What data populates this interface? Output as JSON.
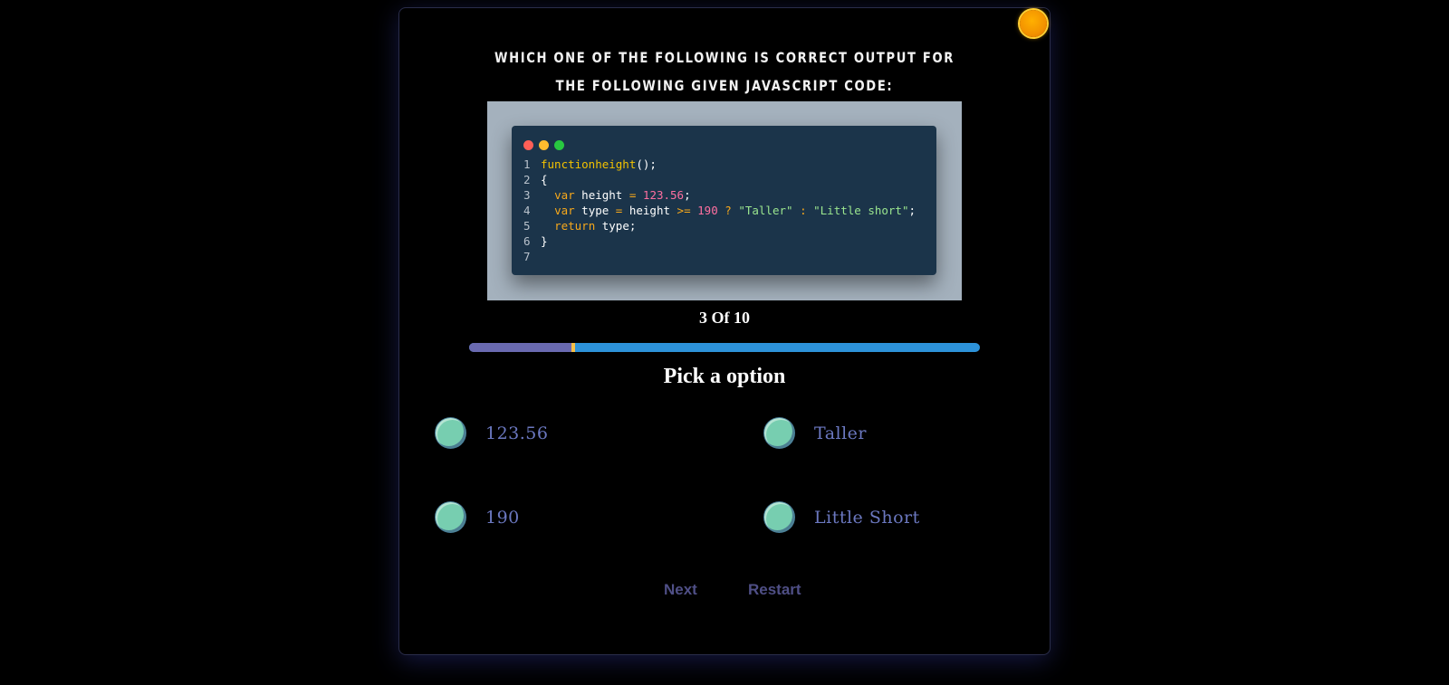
{
  "theme": {
    "toggle_icon": "sun-icon",
    "toggle_color": "#f39200"
  },
  "question": {
    "text": "WHICH ONE OF THE FOLLOWING IS CORRECT OUTPUT FOR THE FOLLOWING GIVEN JAVASCRIPT CODE:"
  },
  "code": {
    "window_dots": [
      "#ff5f57",
      "#febc2e",
      "#28c840"
    ],
    "line_numbers": [
      "1",
      "2",
      "3",
      "4",
      "5",
      "6",
      "7"
    ],
    "lines": [
      "functionheight();",
      "{",
      "  var height = 123.56;",
      "  var type = height >= 190 ? \"Taller\" : \"Little short\";",
      "  return type;",
      "}",
      ""
    ]
  },
  "progress": {
    "label": "3 Of 10",
    "current": 3,
    "total": 10,
    "fraction": 0.2,
    "fill_color": "#6a6ab0",
    "track_color": "#2d92d9",
    "marker_color": "#f5c048"
  },
  "pick": {
    "title": "Pick a option"
  },
  "options": [
    {
      "label": "123.56"
    },
    {
      "label": "Taller"
    },
    {
      "label": "190"
    },
    {
      "label": "Little Short"
    }
  ],
  "buttons": {
    "next": "Next",
    "restart": "Restart"
  }
}
